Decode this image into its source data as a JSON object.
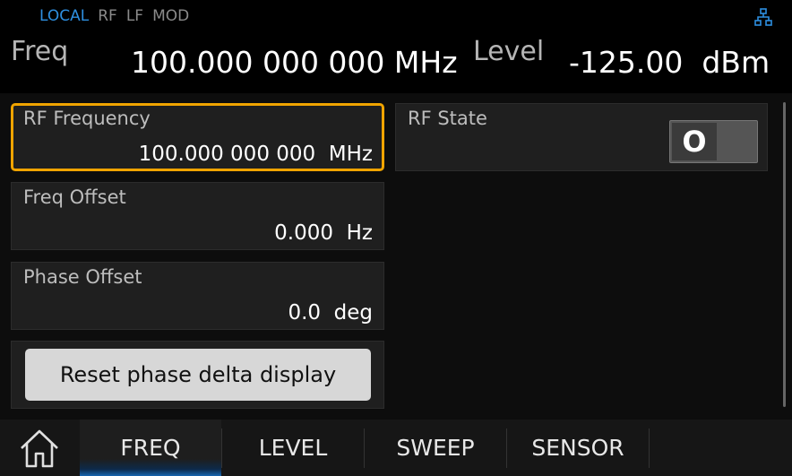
{
  "status": {
    "local": "LOCAL",
    "rf": "RF",
    "lf": "LF",
    "mod": "MOD"
  },
  "header": {
    "freq_label": "Freq",
    "freq_value": "100.000 000 000 MHz",
    "level_label": "Level",
    "level_value": "-125.00  dBm"
  },
  "fields": {
    "rf_frequency": {
      "label": "RF Frequency",
      "value": "100.000 000 000  MHz"
    },
    "freq_offset": {
      "label": "Freq Offset",
      "value": "0.000  Hz"
    },
    "phase_offset": {
      "label": "Phase Offset",
      "value": "0.0  deg"
    },
    "rf_state": {
      "label": "RF State",
      "toggle_text": "O"
    }
  },
  "reset_button": "Reset phase delta display",
  "nav": {
    "home_icon": "home-icon",
    "tabs": [
      {
        "label": "FREQ",
        "active": true
      },
      {
        "label": "LEVEL",
        "active": false
      },
      {
        "label": "SWEEP",
        "active": false
      },
      {
        "label": "SENSOR",
        "active": false
      }
    ]
  },
  "colors": {
    "accent_blue": "#2e8fe0",
    "selection_orange": "#f0a400",
    "background": "#000000",
    "field_bg": "#1f1f1f"
  }
}
